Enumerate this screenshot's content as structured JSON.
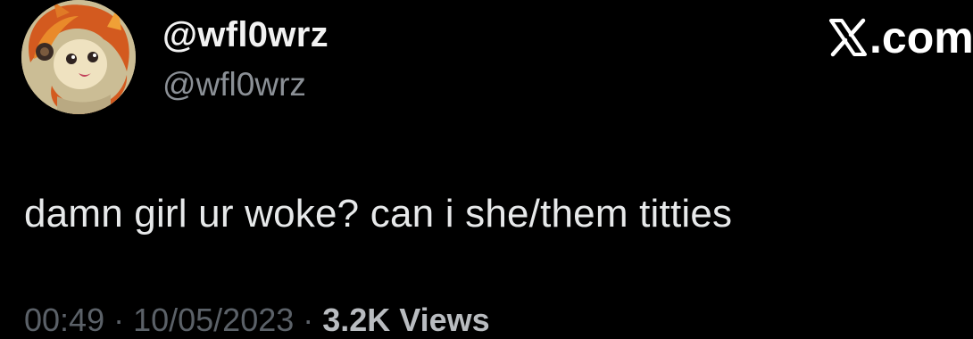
{
  "author": {
    "display_name": "@wfl0wrz",
    "handle": "@wfl0wrz"
  },
  "brand": {
    "label": ".com",
    "icon": "x-logo-icon"
  },
  "tweet": {
    "text": "damn girl ur woke? can i she/them titties"
  },
  "meta": {
    "time_date": "00:49 · 10/05/2023 · ",
    "views": "3.2K Views"
  },
  "colors": {
    "background": "#000000",
    "primary_text": "#e7e9ea",
    "secondary_text": "#8b9096"
  }
}
